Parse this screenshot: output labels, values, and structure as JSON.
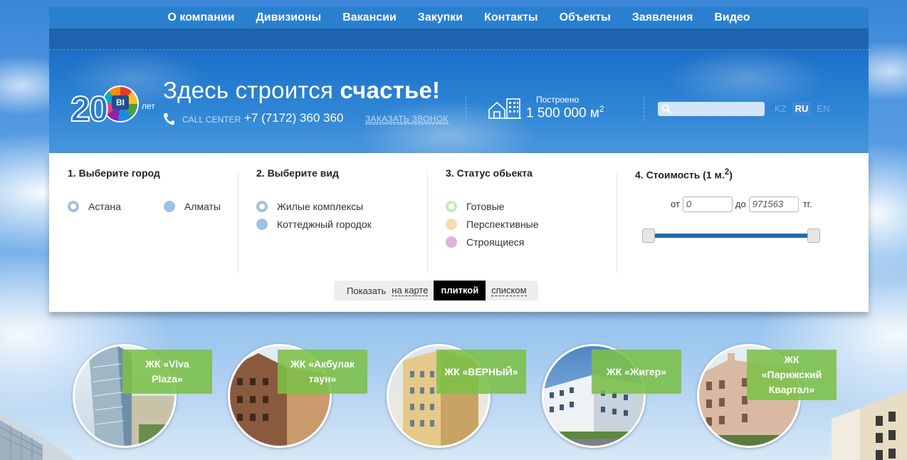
{
  "nav": {
    "items": [
      "О компании",
      "Дивизионы",
      "Вакансии",
      "Закупки",
      "Контакты",
      "Объекты",
      "Заявления",
      "Видео"
    ]
  },
  "logo": {
    "number": "20",
    "badge": "BI",
    "suffix": "лет"
  },
  "header": {
    "slogan_prefix": "Здесь строится",
    "slogan_bold": "счастье!",
    "call_center_label": "CALL CENTER",
    "phone": "+7 (7172) 360 360",
    "callback_link": "ЗАКАЗАТЬ ЗВОНОК",
    "built_label": "Построено",
    "built_value": "1 500 000  м",
    "built_unit_sup": "2",
    "search_placeholder": "",
    "languages": [
      {
        "code": "KZ",
        "active": false
      },
      {
        "code": "RU",
        "active": true
      },
      {
        "code": "EN",
        "active": false
      }
    ]
  },
  "filters": {
    "city": {
      "title": "1. Выберите город",
      "options": [
        "Астана",
        "Алматы"
      ]
    },
    "type": {
      "title": "2. Выберите вид",
      "options": [
        "Жилые комплексы",
        "Коттеджный городок"
      ]
    },
    "status": {
      "title": "3. Статус обьекта",
      "options": [
        "Готовые",
        "Перспективные",
        "Строящиеся"
      ]
    },
    "price": {
      "title": "4. Стоимость (1 м.",
      "title_sup": "2",
      "title_close": ")",
      "from_label": "от",
      "from_value": "0",
      "to_label": "до",
      "to_value": "971563",
      "currency": "тг.",
      "slider_min_fraction": 0,
      "slider_max_fraction": 1
    }
  },
  "view_toggle": {
    "label": "Показать",
    "map": "на карте",
    "tiles": "плиткой",
    "list": "списком",
    "active": "tiles"
  },
  "tiles": [
    {
      "name": "ЖК «Viva Plaza»"
    },
    {
      "name": "ЖК «Акбулак таун»"
    },
    {
      "name": "ЖК «ВЕРНЫЙ»"
    },
    {
      "name": "ЖК «Жигер»"
    },
    {
      "name": "ЖК «Парижский Квартал»"
    }
  ],
  "colors": {
    "nav_bg": "#2a7fcf",
    "header_bg": "#1c6fc7",
    "tile_label_bg": "#7cc048",
    "slider_track": "#2169b9"
  }
}
